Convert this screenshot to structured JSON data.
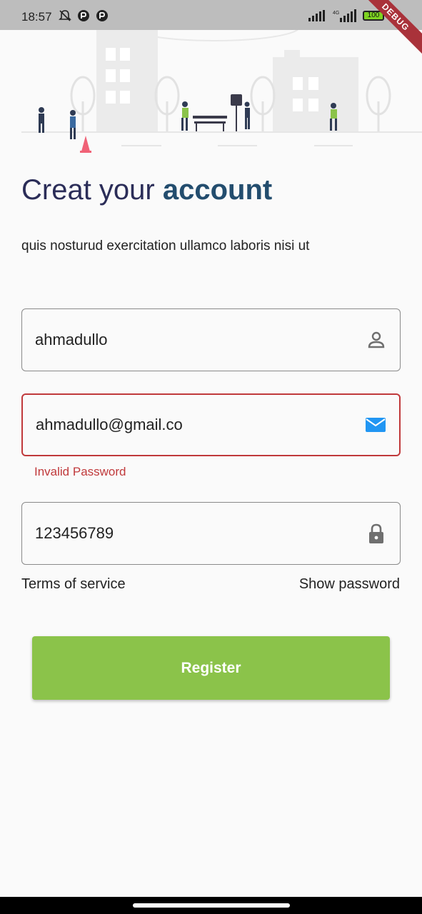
{
  "status_bar": {
    "time": "18:57",
    "battery": "100",
    "network": "4G",
    "debug_label": "DEBUG"
  },
  "header": {
    "title_part1": "Creat your ",
    "title_part2": "account",
    "subtitle": "quis nosturud exercitation ullamco laboris nisi ut"
  },
  "form": {
    "username": {
      "value": "ahmadullo",
      "icon": "person-icon"
    },
    "email": {
      "value": "ahmadullo@gmail.co",
      "icon": "mail-icon",
      "error": "Invalid Password"
    },
    "password": {
      "value": "123456789",
      "icon": "lock-icon"
    }
  },
  "links": {
    "terms": "Terms of service",
    "show_password": "Show password"
  },
  "actions": {
    "register": "Register"
  },
  "colors": {
    "title": "#2b2d58",
    "accent": "#234d6e",
    "error": "#c0393b",
    "button": "#8bc34a",
    "mail_icon": "#2196f3"
  }
}
